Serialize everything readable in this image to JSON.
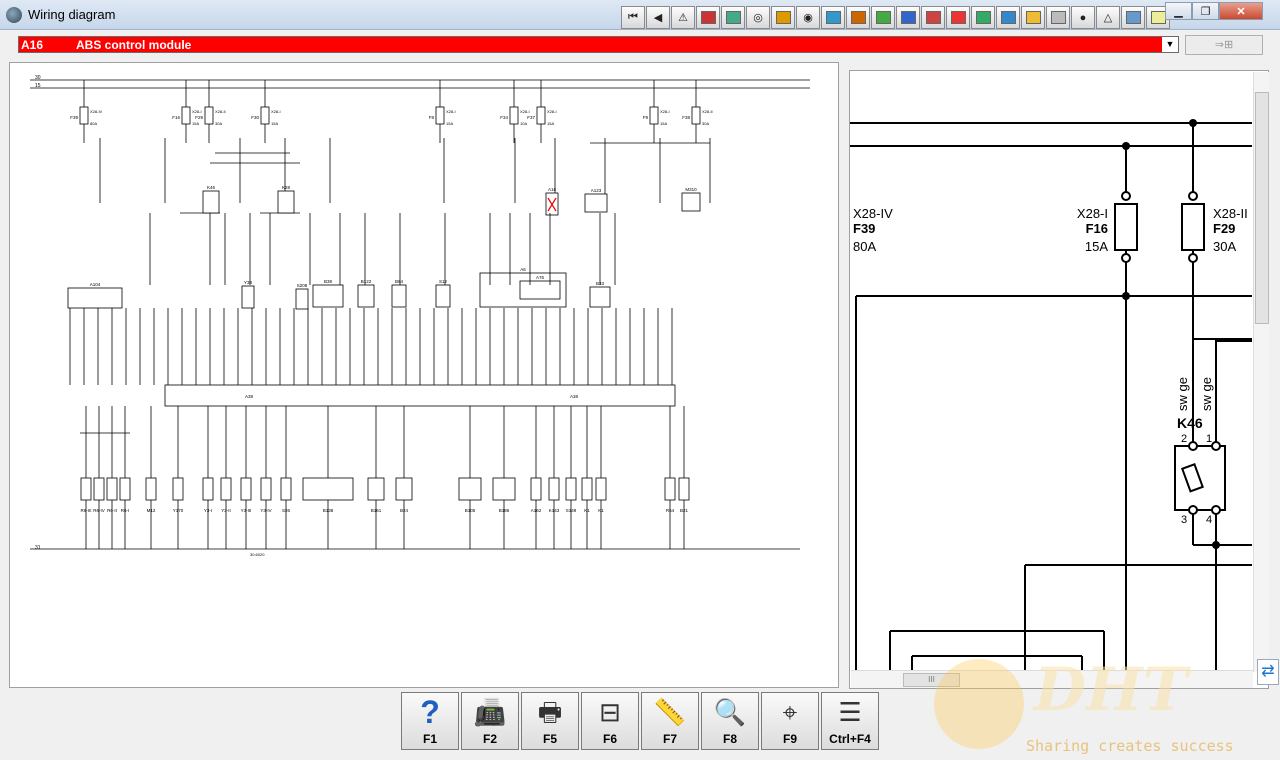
{
  "window": {
    "title": "Wiring diagram"
  },
  "toolbar": {
    "buttons": [
      {
        "name": "first-icon",
        "glyph": "⏮"
      },
      {
        "name": "back-icon",
        "glyph": "◀"
      },
      {
        "name": "warning-icon",
        "glyph": "⚠"
      },
      {
        "name": "color-box-icon",
        "glyph": ""
      },
      {
        "name": "map-icon",
        "glyph": ""
      },
      {
        "name": "compass-icon",
        "glyph": "◎"
      },
      {
        "name": "tools-icon",
        "glyph": ""
      },
      {
        "name": "gauge-icon",
        "glyph": "◉"
      },
      {
        "name": "wrench-icon",
        "glyph": ""
      },
      {
        "name": "chart-icon",
        "glyph": ""
      },
      {
        "name": "panel-icon",
        "glyph": ""
      },
      {
        "name": "people-icon",
        "glyph": ""
      },
      {
        "name": "repair-icon",
        "glyph": ""
      },
      {
        "name": "face-icon",
        "glyph": ""
      },
      {
        "name": "screen-icon",
        "glyph": ""
      },
      {
        "name": "display-icon",
        "glyph": ""
      },
      {
        "name": "dial-icon",
        "glyph": ""
      },
      {
        "name": "hand-icon",
        "glyph": ""
      },
      {
        "name": "person-icon",
        "glyph": "●"
      },
      {
        "name": "alert-icon",
        "glyph": "△"
      },
      {
        "name": "car-icon",
        "glyph": ""
      },
      {
        "name": "note-icon",
        "glyph": ""
      }
    ]
  },
  "window_controls": {
    "minimize": "▁",
    "maximize": "❐",
    "close": "✕"
  },
  "selector": {
    "code": "A16",
    "name": "ABS control module",
    "arrow": "▼"
  },
  "selector_button": {
    "label": "⇒⊞"
  },
  "diagram": {
    "rails_top": [
      "30",
      "15"
    ],
    "rail_bottom": "31",
    "fuses": [
      {
        "conn": "X28-IV",
        "fuse": "F39",
        "amp": "80A"
      },
      {
        "conn": "X28-I",
        "fuse": "F16",
        "amp": "15A"
      },
      {
        "conn": "X28-II",
        "fuse": "F29",
        "amp": "30A"
      },
      {
        "conn": "X28-I",
        "fuse": "F30",
        "amp": "15A"
      },
      {
        "conn": "X28-I",
        "fuse": "F8",
        "amp": "15A"
      },
      {
        "conn": "X28-I",
        "fuse": "F34",
        "amp": "10A"
      },
      {
        "conn": "X28-I",
        "fuse": "F37",
        "amp": "15A"
      },
      {
        "conn": "X28-I",
        "fuse": "F9",
        "amp": "15A"
      },
      {
        "conn": "X28-II",
        "fuse": "F38",
        "amp": "30A"
      }
    ],
    "upper_components": [
      "K46",
      "K28",
      "Y38",
      "S208",
      "B39",
      "B122",
      "B64",
      "S12",
      "A6",
      "A76",
      "A16",
      "A123",
      "B33",
      "M310",
      "A104"
    ],
    "bus_labels": [
      "A38",
      "A38"
    ],
    "lower_components": [
      "R6-III",
      "R6-IV",
      "R6-II",
      "R6-I",
      "M12",
      "Y170",
      "Y3-I",
      "Y3-II",
      "Y3-III",
      "Y3-IV",
      "S26",
      "B138",
      "B161",
      "B24",
      "B105",
      "B186",
      "A162",
      "K143",
      "S149",
      "K1",
      "K1",
      "R64",
      "B21"
    ],
    "ground_label": "30.6020"
  },
  "zoom": {
    "fuses": [
      {
        "conn": "X28-IV",
        "fuse": "F39",
        "amp": "80A"
      },
      {
        "conn": "X28-I",
        "fuse": "F16",
        "amp": "15A"
      },
      {
        "conn": "X28-II",
        "fuse": "F29",
        "amp": "30A"
      }
    ],
    "wire_labels": [
      "sw ge",
      "sw ge"
    ],
    "relay": {
      "name": "K46",
      "pins": [
        "2",
        "1",
        "3",
        "4"
      ]
    }
  },
  "scroll": {
    "h_thumb": "III"
  },
  "fkeys": [
    {
      "name": "help-icon",
      "glyph": "?",
      "label": "F1",
      "color": "#1f5fbf"
    },
    {
      "name": "fax-icon",
      "glyph": "📠",
      "label": "F2",
      "color": "#333333"
    },
    {
      "name": "print-icon",
      "glyph": "🖶",
      "label": "F5",
      "color": "#333333"
    },
    {
      "name": "components-icon",
      "glyph": "⊟",
      "label": "F6",
      "color": "#333333"
    },
    {
      "name": "measure-icon",
      "glyph": "📏",
      "label": "F7",
      "color": "#888888"
    },
    {
      "name": "search-diagram-icon",
      "glyph": "🔍",
      "label": "F8",
      "color": "#333333"
    },
    {
      "name": "locate-icon",
      "glyph": "⌖",
      "label": "F9",
      "color": "#333333"
    },
    {
      "name": "table-icon",
      "glyph": "☰",
      "label": "Ctrl+F4",
      "color": "#333333"
    }
  ],
  "watermark": {
    "logo": "DHT",
    "tagline": "Sharing creates success"
  }
}
